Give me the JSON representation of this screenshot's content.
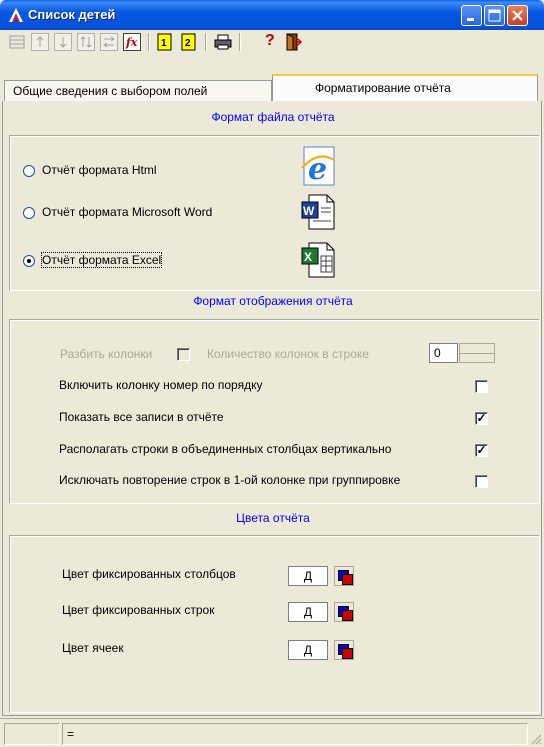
{
  "window": {
    "title": "Список детей",
    "accent": "#0553d9"
  },
  "toolbar": {
    "icons": [
      "grid-icon",
      "arrow-up-icon",
      "arrow-down-icon",
      "sort-icon",
      "swap-icon",
      "fx-icon",
      "page-1-icon",
      "page-2-icon",
      "printer-icon",
      "help-icon",
      "exit-icon"
    ],
    "help_glyph": "?"
  },
  "tabs": {
    "general": "Общие сведения с выбором полей",
    "formatting": "Форматирование отчёта"
  },
  "file_format": {
    "title": "Формат файла отчёта",
    "options": [
      {
        "label": "Отчёт формата Html",
        "icon": "internet-explorer-icon",
        "checked": false
      },
      {
        "label": "Отчёт формата Microsoft Word",
        "icon": "word-document-icon",
        "checked": false
      },
      {
        "label": "Отчёт формата Excel",
        "icon": "excel-document-icon",
        "checked": true
      }
    ]
  },
  "display_format": {
    "title": "Формат отображения отчёта",
    "split_columns": "Разбить колонки",
    "columns_per_row_label": "Количество колонок в строке",
    "columns_per_row_value": "0",
    "options": [
      {
        "label": "Включить колонку номер по порядку",
        "checked": false
      },
      {
        "label": "Показать все записи в отчёте",
        "checked": true
      },
      {
        "label": "Располагать строки в объединенных столбцах вертикально",
        "checked": true
      },
      {
        "label": "Исключать повторение строк в 1-ой колонке при группировке",
        "checked": false
      }
    ]
  },
  "colors": {
    "title": "Цвета отчёта",
    "rows": [
      {
        "label": "Цвет фиксированных столбцов",
        "value": "Д"
      },
      {
        "label": "Цвет фиксированных строк",
        "value": "Д"
      },
      {
        "label": "Цвет ячеек",
        "value": "Д"
      }
    ]
  },
  "status": {
    "cell2": "="
  }
}
